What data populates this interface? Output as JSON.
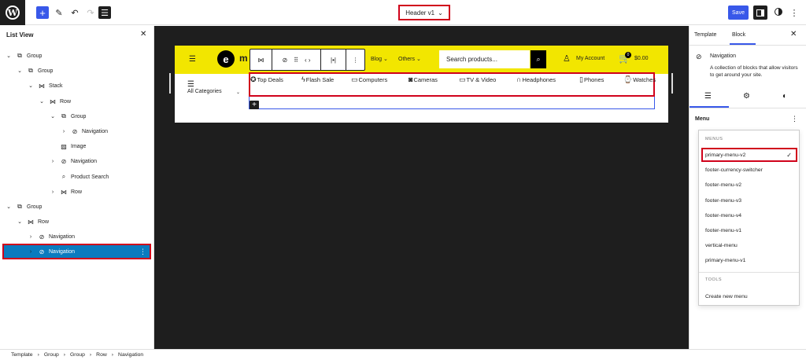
{
  "topbar": {
    "logo": "W",
    "add_icon": "+",
    "edit_icon": "✎",
    "undo_icon": "↶",
    "redo_icon": "↷",
    "list_icon": "☰",
    "document_title": "Header v1",
    "title_chevron": "⌄",
    "save_label": "Save",
    "more_icon": "⋮"
  },
  "list_view": {
    "title": "List View",
    "close_icon": "✕",
    "items": [
      {
        "chevron": "⌄",
        "icon": "⧉",
        "label": "Group"
      },
      {
        "chevron": "⌄",
        "icon": "⧉",
        "label": "Group"
      },
      {
        "chevron": "⌄",
        "icon": "⋈",
        "label": "Stack"
      },
      {
        "chevron": "⌄",
        "icon": "⋈",
        "label": "Row"
      },
      {
        "chevron": "⌄",
        "icon": "⧉",
        "label": "Group"
      },
      {
        "chevron": "›",
        "icon": "⊘",
        "label": "Navigation"
      },
      {
        "chevron": "",
        "icon": "▨",
        "label": "Image"
      },
      {
        "chevron": "›",
        "icon": "⊘",
        "label": "Navigation"
      },
      {
        "chevron": "",
        "icon": "⌕",
        "label": "Product Search"
      },
      {
        "chevron": "›",
        "icon": "⋈",
        "label": "Row"
      },
      {
        "chevron": "⌄",
        "icon": "⧉",
        "label": "Group"
      },
      {
        "chevron": "⌄",
        "icon": "⋈",
        "label": "Row"
      },
      {
        "chevron": "›",
        "icon": "⊘",
        "label": "Navigation"
      },
      {
        "chevron": "›",
        "icon": "⊘",
        "label": "Navigation",
        "options": "⋮"
      }
    ]
  },
  "canvas": {
    "hamburger": "☰",
    "logo_letter": "e",
    "logo_text": "m",
    "toolbar": {
      "row_icon": "⋈",
      "nav_icon": "⊘",
      "drag_icon": "⠿",
      "move_icon": "‹ ›",
      "justify_icon": "|•|",
      "more_icon": "⋮"
    },
    "nav_links": [
      "Blog ⌄",
      "Others ⌄"
    ],
    "search_placeholder": "Search products...",
    "search_icon": "⌕",
    "user_icon": "♙",
    "my_account": "My Account",
    "cart_icon": "🛒",
    "cart_count": "0",
    "cart_total": "$0.00",
    "all_categories_icon": "☰",
    "all_categories": "All Categories",
    "all_categories_chevron": "⌄",
    "menu_items": [
      {
        "icon": "✪",
        "label": "Top Deals"
      },
      {
        "icon": "ϟ",
        "label": "Flash Sale"
      },
      {
        "icon": "▭",
        "label": "Computers"
      },
      {
        "icon": "◙",
        "label": "Cameras"
      },
      {
        "icon": "▭",
        "label": "TV & Video"
      },
      {
        "icon": "∩",
        "label": "Headphones"
      },
      {
        "icon": "▯",
        "label": "Phones"
      },
      {
        "icon": "⌚",
        "label": "Watches"
      }
    ],
    "add_block_icon": "+"
  },
  "sidebar": {
    "tabs": [
      "Template",
      "Block"
    ],
    "close_icon": "✕",
    "block_icon": "⊘",
    "block_title": "Navigation",
    "block_description": "A collection of blocks that allow visitors to get around your site.",
    "subtab_icons": [
      "☰",
      "⚙",
      "◐"
    ],
    "menu_label": "Menu",
    "menu_more": "⋮",
    "menus_heading": "MENUS",
    "menus": [
      "primary-menu-v2",
      "footer-currency-switcher",
      "footer-menu-v2",
      "footer-menu-v3",
      "footer-menu-v4",
      "footer-menu-v1",
      "vertical-menu",
      "primary-menu-v1"
    ],
    "selected_check": "✓",
    "tools_heading": "TOOLS",
    "create_new_menu": "Create new menu"
  },
  "footer": {
    "breadcrumbs": [
      "Template",
      "›",
      "Group",
      "›",
      "Group",
      "›",
      "Row",
      "›",
      "Navigation"
    ]
  },
  "colors": {
    "accent": "#3858e9",
    "header_yellow": "#f2e600",
    "highlight_red": "#d0021b",
    "selected_row": "#0b7bbf",
    "canvas_bg": "#1e1e1e"
  }
}
